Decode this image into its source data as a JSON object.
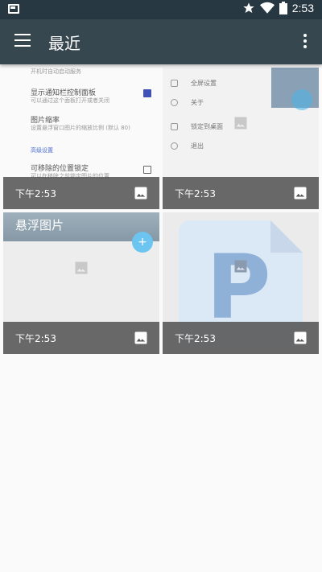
{
  "status_bar": {
    "time": "2:53"
  },
  "app_bar": {
    "title": "最近"
  },
  "cards": [
    {
      "time": "下午2:53",
      "settings_lines": [
        "开机时自动启动服务",
        "显示通知栏控制面板",
        "可以通过这个面板打开或者关闭",
        "图片缩率",
        "设置悬浮窗口图片的缩放比例 (默认 80)",
        "高级设置",
        "可移除的位置锁定",
        "可以在移除之前锁定图片的位置"
      ]
    },
    {
      "time": "下午2:53",
      "menu_items": [
        "全屏设置",
        "关于",
        "锁定到桌面",
        "退出"
      ]
    },
    {
      "time": "下午2:53",
      "caption": "悬浮图片"
    },
    {
      "time": "下午2:53",
      "letter": "P"
    }
  ]
}
